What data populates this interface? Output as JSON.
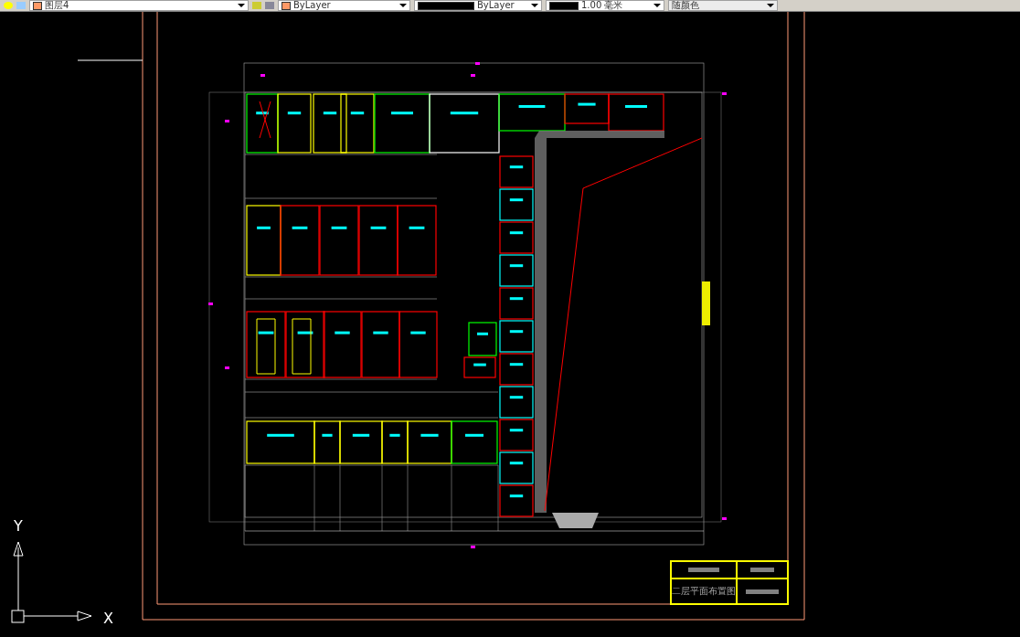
{
  "toolbar": {
    "layer": "图层4",
    "color_setting": "ByLayer",
    "linetype": "ByLayer",
    "lineweight": "1.00 毫米",
    "plot_style": "随颜色"
  },
  "ucs": {
    "x_label": "X",
    "y_label": "Y"
  },
  "title_block": {
    "title": "二层平面布置图"
  }
}
